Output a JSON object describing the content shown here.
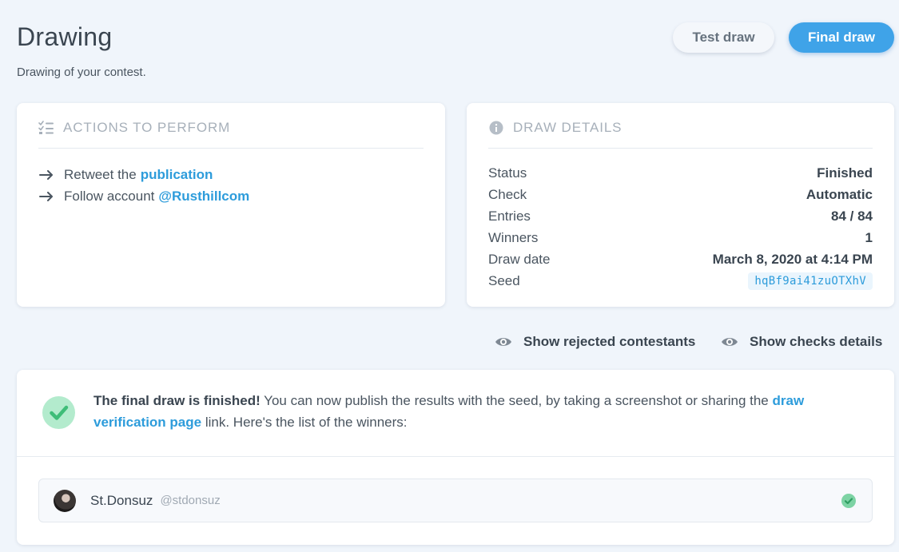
{
  "header": {
    "title": "Drawing",
    "subtitle": "Drawing of your contest."
  },
  "buttons": {
    "test_draw": "Test draw",
    "final_draw": "Final draw"
  },
  "actions_card": {
    "title": "ACTIONS TO PERFORM",
    "icon": "checklist-icon",
    "items": [
      {
        "text": "Retweet the",
        "link": "publication"
      },
      {
        "text": "Follow account",
        "link": "@Rusthillcom"
      }
    ]
  },
  "details_card": {
    "title": "DRAW DETAILS",
    "icon": "info-icon",
    "rows": [
      {
        "label": "Status",
        "value": "Finished"
      },
      {
        "label": "Check",
        "value": "Automatic"
      },
      {
        "label": "Entries",
        "value": "84 / 84"
      },
      {
        "label": "Winners",
        "value": "1"
      },
      {
        "label": "Draw date",
        "value": "March 8, 2020 at 4:14 PM"
      },
      {
        "label": "Seed",
        "value": "hqBf9ai41zuOTXhV"
      }
    ]
  },
  "toggles": {
    "rejected": "Show rejected contestants",
    "checks": "Show checks details"
  },
  "result": {
    "strong": "The final draw is finished!",
    "text_before_link": " You can now publish the results with the seed, by taking a screenshot or sharing the ",
    "link": "draw verification page",
    "text_after_link": " link. Here's the list of the winners:"
  },
  "winners": [
    {
      "name": "St.Donsuz",
      "handle": "@stdonsuz"
    }
  ],
  "colors": {
    "accent": "#2d9cdb",
    "primary_button": "#3fa3e8",
    "success": "#58c98b",
    "background": "#f0f5fb"
  }
}
